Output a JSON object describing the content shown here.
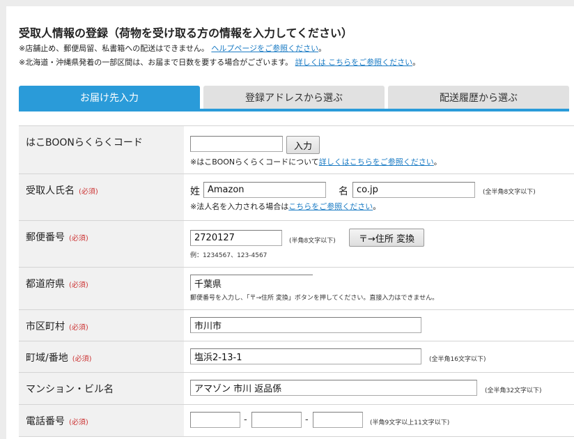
{
  "header": {
    "title": "受取人情報の登録（荷物を受け取る方の情報を入力してください）",
    "note1_text": "※店舗止め、郵便局留、私書箱への配送はできません。",
    "note1_link": "ヘルプページをご参照ください",
    "note1_after": "。",
    "note2_text": "※北海道・沖縄県発着の一部区間は、お届まで日数を要する場合がございます。",
    "note2_link": "詳しくは こちらをご参照ください",
    "note2_after": "。"
  },
  "tabs": [
    {
      "label": "お届け先入力",
      "active": true
    },
    {
      "label": "登録アドレスから選ぶ",
      "active": false
    },
    {
      "label": "配送履歴から選ぶ",
      "active": false
    }
  ],
  "form": {
    "required_mark": "(必須)",
    "haco": {
      "label": "はこBOONらくらくコード",
      "value": "",
      "button": "入力",
      "note_text": "※はこBOONらくらくコードについて",
      "note_link": "詳しくはこちらをご参照ください",
      "note_after": "。"
    },
    "name": {
      "label": "受取人氏名",
      "sei_label": "姓",
      "sei_value": "Amazon",
      "mei_label": "名",
      "mei_value": "co.jp",
      "hint": "(全半角8文字以下)",
      "note_text": "※法人名を入力される場合は",
      "note_link": "こちらをご参照ください",
      "note_after": "。"
    },
    "postal": {
      "label": "郵便番号",
      "value": "2720127",
      "hint": "(半角8文字以下)",
      "button": "〒→住所 変換",
      "example": "例：1234567、123-4567"
    },
    "prefecture": {
      "label": "都道府県",
      "value": "千葉県",
      "note": "郵便番号を入力し、「〒→住所 変換」ボタンを押してください。直接入力はできません。"
    },
    "city": {
      "label": "市区町村",
      "value": "市川市"
    },
    "street": {
      "label": "町域/番地",
      "value": "塩浜2-13-1",
      "hint": "(全半角16文字以下)"
    },
    "building": {
      "label": "マンション・ビル名",
      "value": "アマゾン 市川 返品係",
      "hint": "(全半角32文字以下)"
    },
    "phone": {
      "label": "電話番号",
      "part1": "",
      "part2": "",
      "part3": "",
      "separator": "-",
      "hint": "(半角9文字以上11文字以下)"
    }
  }
}
